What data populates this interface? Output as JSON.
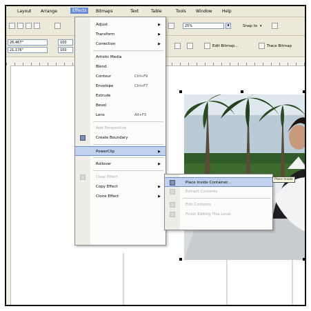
{
  "menubar": [
    "Layout",
    "Arrange",
    "Effects",
    "Bitmaps",
    "Text",
    "Table",
    "Tools",
    "Window",
    "Help"
  ],
  "menubar_open_index": 2,
  "toolbar": {
    "zoom_value": "25%",
    "snap_label": "Snap to",
    "edit_bitmap_label": "Edit Bitmap...",
    "trace_bitmap_label": "Trace Bitmap"
  },
  "propbar": {
    "x_value": "26.467\"",
    "y_value": "21.176\"",
    "w_value": "100",
    "h_value": "100"
  },
  "effects_menu": [
    {
      "label": "Adjust",
      "arrow": true
    },
    {
      "label": "Transform",
      "arrow": true
    },
    {
      "label": "Correction",
      "arrow": true
    },
    {
      "sep": true
    },
    {
      "label": "Artistic Media"
    },
    {
      "label": "Blend"
    },
    {
      "label": "Contour",
      "shortcut": "Ctrl+F9"
    },
    {
      "label": "Envelope",
      "shortcut": "Ctrl+F7"
    },
    {
      "label": "Extrude"
    },
    {
      "label": "Bevel"
    },
    {
      "label": "Lens",
      "shortcut": "Alt+F3"
    },
    {
      "sep": true
    },
    {
      "label": "Add Perspective",
      "disabled": true
    },
    {
      "label": "Create Boundary",
      "icon": true
    },
    {
      "sep": true
    },
    {
      "label": "PowerClip",
      "arrow": true,
      "highlighted": true
    },
    {
      "sep": true
    },
    {
      "label": "Rollover",
      "arrow": true
    },
    {
      "sep": true
    },
    {
      "label": "Clear Effect",
      "disabled": true,
      "icon": true
    },
    {
      "label": "Copy Effect",
      "arrow": true
    },
    {
      "label": "Clone Effect",
      "arrow": true
    }
  ],
  "powerclip_submenu": [
    {
      "label": "Place Inside Container...",
      "highlighted": true
    },
    {
      "label": "Extract Contents",
      "disabled": true
    },
    {
      "sep": true
    },
    {
      "label": "Edit Contents",
      "disabled": true
    },
    {
      "label": "Finish Editing This Level",
      "disabled": true
    }
  ],
  "tooltip": "Place Inside",
  "colors": {
    "menu_highlight": "#c1d2ee",
    "menu_highlight_border": "#6a8ed6",
    "chrome": "#ece9d8"
  }
}
